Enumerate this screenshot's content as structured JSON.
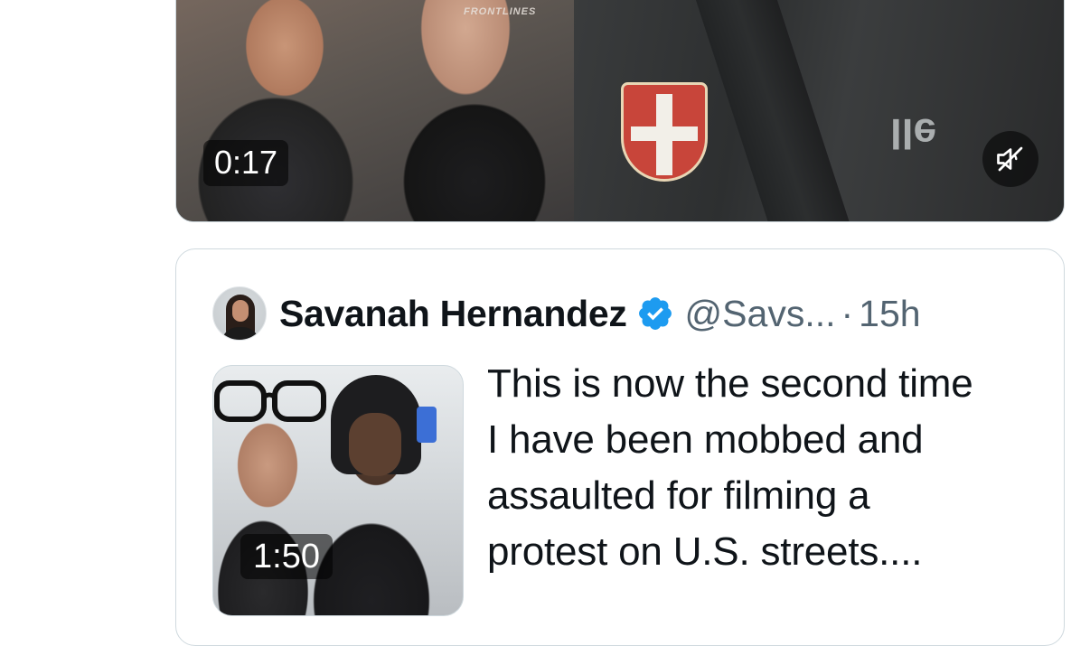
{
  "media_video": {
    "duration": "0:17",
    "watermark": "FRONTLINES",
    "icons": {
      "mute": "speaker-muted-icon"
    }
  },
  "quoted_tweet": {
    "author": {
      "name": "Savanah Hernandez",
      "handle": "@Savs...",
      "verified": true
    },
    "separator": "·",
    "time": "15h",
    "text_lines": [
      "This is now the second time",
      "I have been mobbed and",
      "assaulted for filming a",
      "protest on U.S. streets...."
    ],
    "media": {
      "duration": "1:50"
    }
  },
  "colors": {
    "verified_blue": "#1d9bf0",
    "secondary_text": "#536471",
    "border": "#cfd9de"
  }
}
